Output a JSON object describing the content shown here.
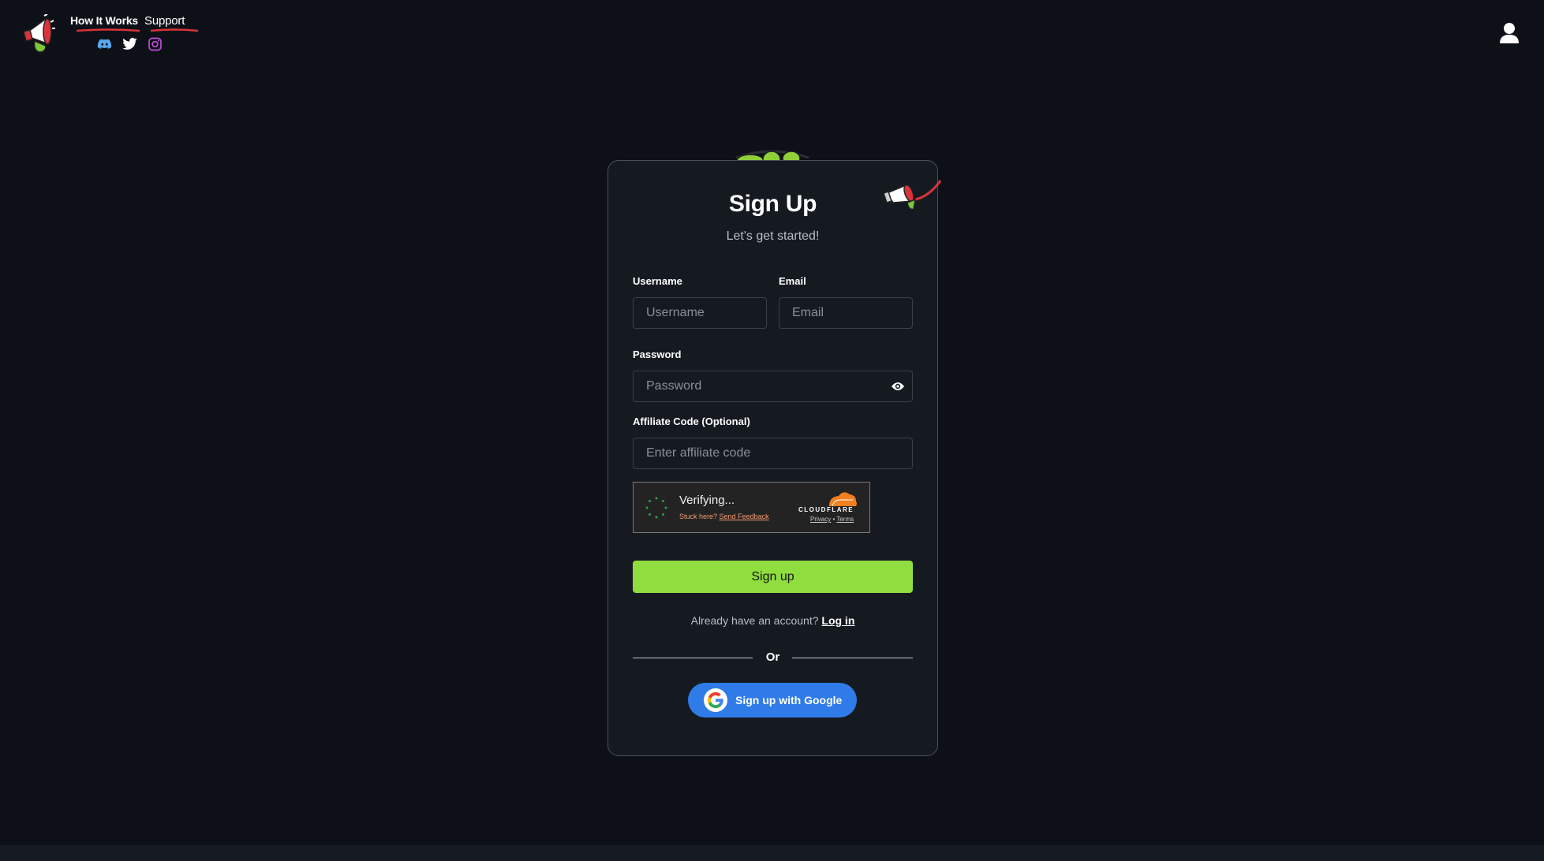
{
  "header": {
    "nav": [
      {
        "label": "How It Works"
      },
      {
        "label": "Support"
      }
    ],
    "social_icons": [
      "discord-icon",
      "twitter-icon",
      "instagram-icon"
    ],
    "account_icon": "user-icon"
  },
  "signup": {
    "title": "Sign Up",
    "subtitle": "Let's get started!",
    "username": {
      "label": "Username",
      "placeholder": "Username",
      "value": ""
    },
    "email": {
      "label": "Email",
      "placeholder": "Email",
      "value": ""
    },
    "password": {
      "label": "Password",
      "placeholder": "Password",
      "value": ""
    },
    "affiliate": {
      "label": "Affiliate Code (Optional)",
      "placeholder": "Enter affiliate code",
      "value": ""
    },
    "captcha": {
      "status": "Verifying...",
      "stuck_text": "Stuck here?",
      "feedback_link": "Send Feedback",
      "brand": "CLOUDFLARE",
      "privacy_link": "Privacy",
      "separator": "•",
      "terms_link": "Terms"
    },
    "submit_label": "Sign up",
    "login_prompt": "Already have an account?",
    "login_link": "Log in",
    "divider_label": "Or",
    "google_label": "Sign up with Google"
  },
  "colors": {
    "background": "#0d1117",
    "card": "#151a21",
    "primary_button": "#8fdd3e",
    "google_button": "#2f7be8",
    "discord": "#5aa8f0",
    "instagram": "#c04fe0",
    "cloudflare": "#f38020"
  }
}
